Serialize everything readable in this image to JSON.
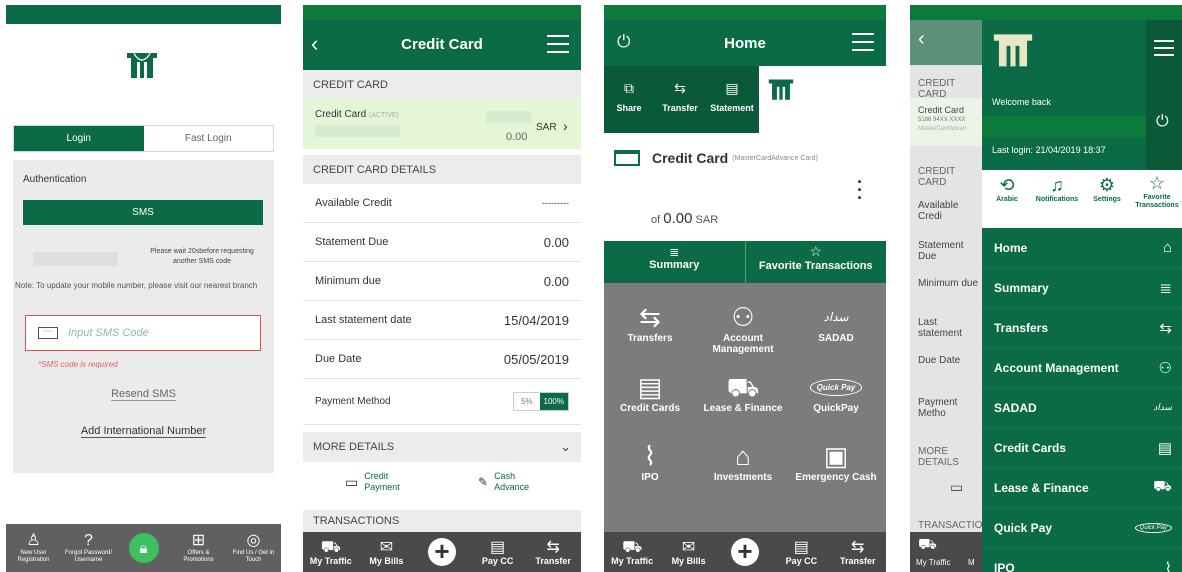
{
  "login": {
    "tabs": [
      "Login",
      "Fast Login"
    ],
    "auth_label": "Authentication",
    "sms_button": "SMS",
    "wait_text": "Please wait 20sbefore requesting another SMS code",
    "note": "Note: To update your mobile number, please visit our nearest branch",
    "input_placeholder": "Input SMS Code",
    "error": "*SMS code is required",
    "resend": "Resend SMS",
    "add_number": "Add International Number",
    "bottom": [
      {
        "icon": "user-icon",
        "label": "New User Registration"
      },
      {
        "icon": "question-icon",
        "label": "Forgot Password/ Username"
      },
      {
        "icon": "lock-icon",
        "label": ""
      },
      {
        "icon": "gift-icon",
        "label": "Offers & Promotions"
      },
      {
        "icon": "location-icon",
        "label": "Find Us / Get in Touch"
      }
    ]
  },
  "credit": {
    "title": "Credit Card",
    "section1": "CREDIT CARD",
    "card_name": "Credit Card",
    "card_status": "(ACTIVE)",
    "card_amount": "0.00",
    "card_currency": "SAR",
    "section2": "CREDIT CARD DETAILS",
    "details": [
      {
        "label": "Available Credit",
        "value": "---------"
      },
      {
        "label": "Statement Due",
        "value": "0.00"
      },
      {
        "label": "Minimum due",
        "value": "0.00"
      },
      {
        "label": "Last statement date",
        "value": "15/04/2019"
      },
      {
        "label": "Due Date",
        "value": "05/05/2019"
      }
    ],
    "payment_label": "Payment Method",
    "payment_options": [
      "5%",
      "100%"
    ],
    "more_details": "MORE DETAILS",
    "action1": "Credit Payment",
    "action2": "Cash Advance",
    "transactions": "TRANSACTIONS"
  },
  "home": {
    "title": "Home",
    "quick": [
      "Share",
      "Transfer",
      "Statement"
    ],
    "card_name": "Credit Card",
    "card_type": "(MasterCardAdvance Card)",
    "of_label": "of",
    "amount": "0.00",
    "currency": "SAR",
    "tabs": [
      "Summary",
      "Favorite Transactions"
    ],
    "grid": [
      {
        "icon": "transfer-icon",
        "label": "Transfers"
      },
      {
        "icon": "account-management-icon",
        "label": "Account Management"
      },
      {
        "icon": "sadad-icon",
        "label": "SADAD"
      },
      {
        "icon": "credit-cards-icon",
        "label": "Credit Cards"
      },
      {
        "icon": "lease-icon",
        "label": "Lease & Finance"
      },
      {
        "icon": "quickpay-icon",
        "label": "QuickPay"
      },
      {
        "icon": "ipo-icon",
        "label": "IPO"
      },
      {
        "icon": "investments-icon",
        "label": "Investments"
      },
      {
        "icon": "emergency-cash-icon",
        "label": "Emergency Cash"
      }
    ],
    "sadad_logo": "سداد",
    "quickpay_logo": "Quick Pay"
  },
  "shared_bottom": [
    "My Traffic",
    "My Bills",
    "",
    "Pay CC",
    "Transfer"
  ],
  "menu": {
    "welcome": "Welcome back",
    "last_login": "Last login: 21/04/2019 18:37",
    "icons": [
      "Arabic",
      "Notifications",
      "Settings",
      "Favorite Transactions"
    ],
    "items": [
      "Home",
      "Summary",
      "Transfers",
      "Account Management",
      "SADAD",
      "Credit Cards",
      "Lease & Finance",
      "Quick Pay",
      "IPO"
    ],
    "bg_labels": [
      "CREDIT CARD",
      "Credit Card",
      "5186 94XX XXXX",
      "MasterCardAdvan",
      "CREDIT CARD",
      "Available Credi",
      "Statement Due",
      "Minimum due",
      "Last statement",
      "Due Date",
      "Payment Metho",
      "MORE DETAILS",
      "TRANSACTION",
      "My Traffic",
      "M"
    ]
  },
  "colors": {
    "primary": "#0a6b46",
    "dark": "#0a5a3a",
    "gray": "#7a7a7a",
    "bar": "#4a4a4a"
  }
}
